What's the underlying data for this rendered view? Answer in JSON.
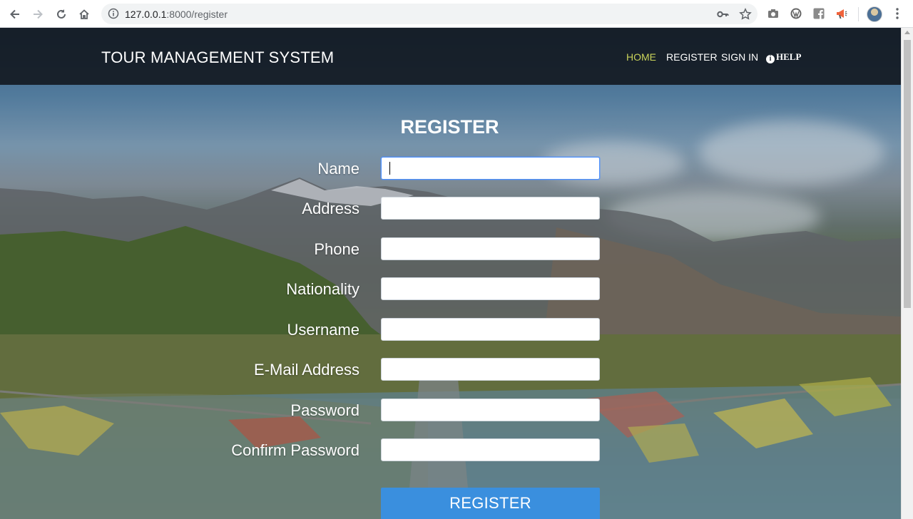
{
  "browser": {
    "url_host": "127.0.0.1",
    "url_path": ":8000/register",
    "nav_icons": [
      "back-arrow-icon",
      "forward-arrow-icon",
      "reload-icon",
      "home-icon"
    ],
    "extension_icons": [
      "camera-icon",
      "wordpress-icon",
      "facebook-icon",
      "megaphone-icon"
    ]
  },
  "navbar": {
    "brand": "TOUR MANAGEMENT SYSTEM",
    "links": [
      {
        "label": "HOME",
        "active": true
      },
      {
        "label": "REGISTER",
        "active": false
      },
      {
        "label": "SIGN IN",
        "active": false
      },
      {
        "label": "HELP",
        "active": false
      }
    ]
  },
  "form": {
    "title": "REGISTER",
    "fields": [
      {
        "label": "Name",
        "value": ""
      },
      {
        "label": "Address",
        "value": ""
      },
      {
        "label": "Phone",
        "value": ""
      },
      {
        "label": "Nationality",
        "value": ""
      },
      {
        "label": "Username",
        "value": ""
      },
      {
        "label": "E-Mail Address",
        "value": ""
      },
      {
        "label": "Password",
        "value": ""
      },
      {
        "label": "Confirm Password",
        "value": ""
      }
    ],
    "submit_label": "REGISTER"
  },
  "colors": {
    "navbar_bg": "#11161c",
    "active_link": "#c9d35a",
    "submit_bg": "#3a8fde"
  }
}
